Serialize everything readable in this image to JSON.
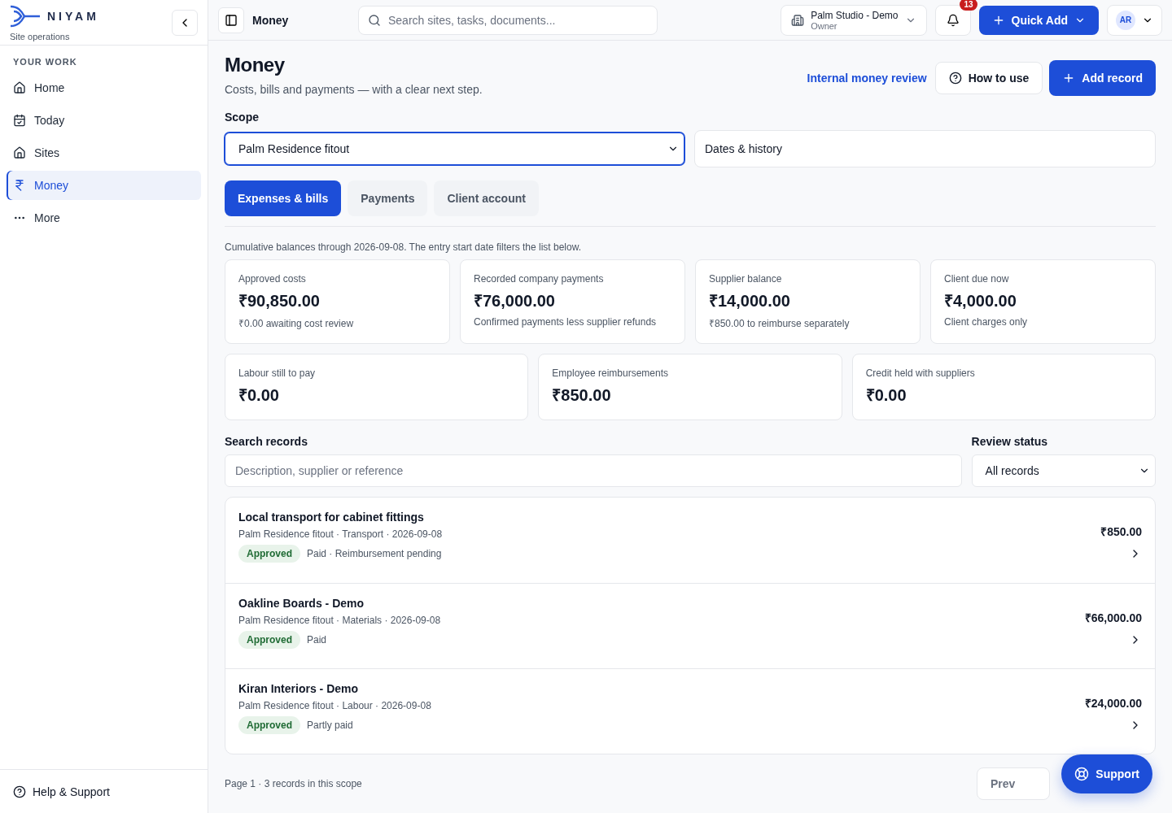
{
  "brand": {
    "name": "NIYAM",
    "subtitle": "Site operations"
  },
  "sidebar": {
    "section": "YOUR WORK",
    "items": [
      {
        "label": "Home",
        "selected": false
      },
      {
        "label": "Today",
        "selected": false
      },
      {
        "label": "Sites",
        "selected": false
      },
      {
        "label": "Money",
        "selected": true
      },
      {
        "label": "More",
        "selected": false
      }
    ],
    "footer": "Help & Support"
  },
  "topbar": {
    "title": "Money",
    "search_placeholder": "Search sites, tasks, documents...",
    "org": {
      "name": "Palm Studio - Demo",
      "role": "Owner"
    },
    "notifications": "13",
    "quick_add": "Quick Add",
    "avatar": "AR"
  },
  "page": {
    "title": "Money",
    "subtitle": "Costs, bills and payments — with a clear next step.",
    "link": "Internal money review",
    "how_to": "How to use",
    "add": "Add record"
  },
  "scope": {
    "label": "Scope",
    "value": "Palm Residence fitout",
    "dates": "Dates & history"
  },
  "tabs": [
    {
      "label": "Expenses & bills",
      "selected": true
    },
    {
      "label": "Payments",
      "selected": false
    },
    {
      "label": "Client account",
      "selected": false
    }
  ],
  "note": "Cumulative balances through 2026-09-08. The entry start date filters the list below.",
  "stats_row1": [
    {
      "label": "Approved costs",
      "value": "₹90,850.00",
      "detail": "₹0.00 awaiting cost review"
    },
    {
      "label": "Recorded company payments",
      "value": "₹76,000.00",
      "detail": "Confirmed payments less supplier refunds"
    },
    {
      "label": "Supplier balance",
      "value": "₹14,000.00",
      "detail": "₹850.00 to reimburse separately"
    },
    {
      "label": "Client due now",
      "value": "₹4,000.00",
      "detail": "Client charges only"
    }
  ],
  "stats_row2": [
    {
      "label": "Labour still to pay",
      "value": "₹0.00"
    },
    {
      "label": "Employee reimbursements",
      "value": "₹850.00"
    },
    {
      "label": "Credit held with suppliers",
      "value": "₹0.00"
    }
  ],
  "filters": {
    "search_label": "Search records",
    "search_placeholder": "Description, supplier or reference",
    "status_label": "Review status",
    "status_value": "All records"
  },
  "records": [
    {
      "title": "Local transport for cabinet fittings",
      "meta": "Palm Residence fitout · Transport · 2026-09-08",
      "status": "Approved",
      "payment": "Paid · Reimbursement pending",
      "amount": "₹850.00"
    },
    {
      "title": "Oakline Boards - Demo",
      "meta": "Palm Residence fitout · Materials · 2026-09-08",
      "status": "Approved",
      "payment": "Paid",
      "amount": "₹66,000.00"
    },
    {
      "title": "Kiran Interiors - Demo",
      "meta": "Palm Residence fitout · Labour · 2026-09-08",
      "status": "Approved",
      "payment": "Partly paid",
      "amount": "₹24,000.00"
    }
  ],
  "pagination": {
    "summary": "Page 1 · 3 records in this scope",
    "prev": "Prev"
  },
  "support": "Support"
}
